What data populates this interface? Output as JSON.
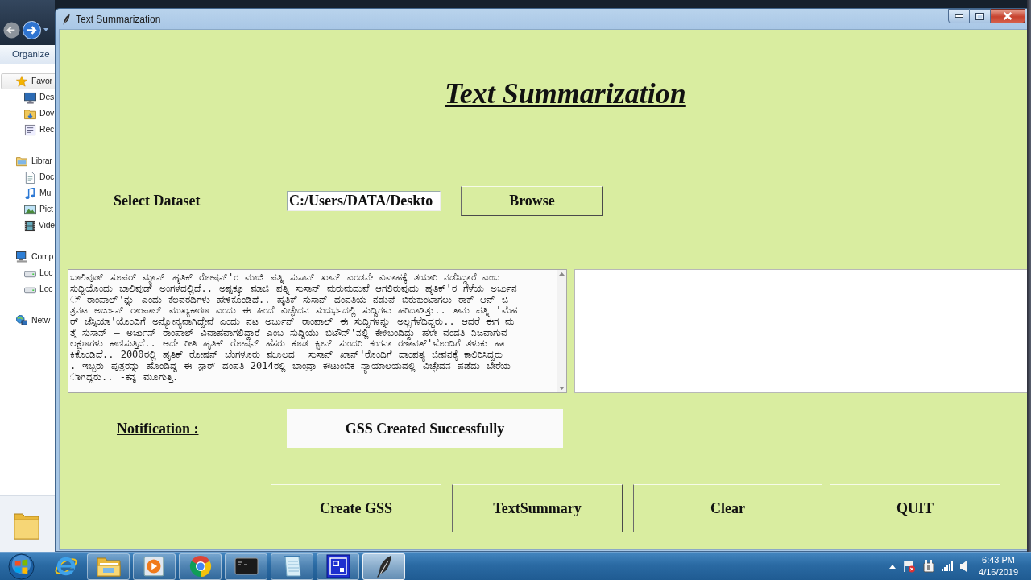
{
  "explorer": {
    "toolbar": "Organize",
    "nav": [
      {
        "label": "Favor",
        "kind": "favorites",
        "selected": true,
        "children": [
          {
            "label": "Des",
            "kind": "desktop",
            "selected": false
          },
          {
            "label": "Dov",
            "kind": "downloads",
            "selected": false
          },
          {
            "label": "Rec",
            "kind": "recent",
            "selected": false
          }
        ]
      },
      {
        "label": "Librar",
        "kind": "libraries",
        "selected": false,
        "children": [
          {
            "label": "Doc",
            "kind": "documents",
            "selected": false
          },
          {
            "label": "Mu",
            "kind": "music",
            "selected": false
          },
          {
            "label": "Pict",
            "kind": "pictures",
            "selected": false
          },
          {
            "label": "Vide",
            "kind": "videos",
            "selected": false
          }
        ]
      },
      {
        "label": "Comp",
        "kind": "computer",
        "selected": false,
        "children": [
          {
            "label": "Loc",
            "kind": "drive",
            "selected": false
          },
          {
            "label": "Loc",
            "kind": "drive",
            "selected": false
          }
        ]
      },
      {
        "label": "Netw",
        "kind": "network",
        "selected": false
      }
    ]
  },
  "window": {
    "title": "Text Summarization"
  },
  "heading": "Text Summarization",
  "dataset": {
    "label": "Select Dataset",
    "value": "C:/Users/DATA/Deskto",
    "button": "Browse"
  },
  "input_text": {
    "lines": [
      "ಬಾಲಿವುಡ್ ಸೂಪರ್ ಮ್ಯಾನ್ ಹೃತಿಕ್ ರೋಷನ್'ರ ಮಾಜಿ ಪತ್ನಿ ಸುಸಾನ್ ಖಾನ್ ಎರಡನೇ ವಿವಾಹಕ್ಕೆ ತಯಾರಿ ನಡೆಸಿದ್ದಾರೆ ಎಂಬ",
      "ಸುದ್ದಿಯೊಂದು ಬಾಲಿವುಡ್ ಅಂಗಳದಲ್ಲಿದೆ.. ಅಷ್ಟಕ್ಕೂ ಮಾಜಿ ಪತ್ನಿ ಸುಸಾನ್ ಮರುಮದುವೆ ಆಗಲಿರುವುದು ಹೃತಿಕ್'ರ ಗೆಳೆಯ ಅರ್ಜುನ",
      "್ ರಾಂಪಾಲ್'ನ್ನು ಎಂದು ಕೆಲವರದಿಗಳು ಹೇಳಿಕೊಂಡಿದೆ.. ಹೃತಿಕ್-ಸುಸಾನ್ ದಂಪತಿಯ ನಡುವೆ ಬಿರುಕುಂಟಾಗಲು ರಾಕ್ ಆನ್ ಚಿ",
      "ತ್ರನಟ ಅರ್ಜುನ್ ರಾಂಪಾಲ್ ಮುಖ್ಯಕಾರಣ ಎಂದು ಈ ಹಿಂದೆ ವಿಚ್ಛೇದನ ಸಂದರ್ಭದಲ್ಲಿ ಸುದ್ದಿಗಳು ಹರಿದಾಡಿತ್ತು.. ತಾನು ಪತ್ನಿ 'ಮೆಹ",
      "ರ್ ಜೆಸ್ಸಿಯಾ'ಯೊಂದಿಗೆ ಅನ್ಯೋನ್ಯವಾಗಿದ್ದೇವೆ ಎಂದು ನಟ ಅರ್ಜುನ್ ರಾಂಪಾಲ್ ಈ ಸುದ್ದಿಗಳನ್ನು ಅಲ್ಲಗೆಳೆದಿದ್ದರು.. ಆದರೆ ಈಗ ಮ",
      "ತ್ತೆ ಸುಸಾನ್ – ಅರ್ಜುನ್ ರಾಂಪಾಲ್ ವಿವಾಹವಾಗಲಿದ್ದಾರೆ ಎಂಬ ಸುದ್ದಿಯು ಬಿಟೌನ್'ನಲ್ಲಿ ಕೇಳಿಬಂದಿದ್ದು ಹಳೇ ವಂದತಿ ನಿಜವಾಗುವ",
      "ಲಕ್ಷಣಗಳು ಕಾಣಿಸುತ್ತಿದೆ.. ಅದೇ ರೀತಿ ಹೃತಿಕ್ ರೋಷನ್ ಹೆಸರು ಕೂಡ ಕ್ವೀನ್ ಸುಂದರಿ ಕಂಗನಾ ರಣಾವತ್'ಳೊಂದಿಗೆ ತಳುಕು ಹಾ",
      "ಕಿಕೊಂಡಿದೆ.. 2000ರಲ್ಲಿ ಹೃತಿಕ್ ರೋಷನ್ ಬೆಂಗಳೂರು ಮೂಲದ  ಸುಸಾನ್ ಖಾನ್'ರೊಂದಿಗೆ ದಾಂಪತ್ಯ ಜೀವನಕ್ಕೆ ಕಾಲಿರಿಸಿದ್ದರು",
      ". ಇಬ್ಬರು ಪುತ್ರರನ್ನು ಹೊಂದಿದ್ದ ಈ ಸ್ಟಾರ್ ದಂಪತಿ 2014ರಲ್ಲಿ ಬಾಂದ್ರಾ ಕೌಟುಂಬಿಕ ನ್ಯಾಯಾಲಯದಲ್ಲಿ ವಿಚ್ಛೇದನ ಪಡೆದು ಬೇರೆಯ",
      "ಾಗಿದ್ದರು.. -ಕನ್ನ ಮೂಗುತ್ತಿ."
    ]
  },
  "notification": {
    "label": "Notification :",
    "message": "GSS Created Successfully"
  },
  "buttons": [
    "Create GSS",
    "TextSummary",
    "Clear",
    "QUIT"
  ],
  "taskbar": {
    "apps": [
      {
        "kind": "browser",
        "running": false,
        "selected": false
      },
      {
        "kind": "folder",
        "running": true,
        "selected": false
      },
      {
        "kind": "media",
        "running": true,
        "selected": false
      },
      {
        "kind": "chrome",
        "running": true,
        "selected": false
      },
      {
        "kind": "terminal",
        "running": true,
        "selected": false
      },
      {
        "kind": "notepad",
        "running": true,
        "selected": false
      },
      {
        "kind": "blue-app",
        "running": true,
        "selected": false
      },
      {
        "kind": "feather",
        "running": true,
        "selected": true
      }
    ],
    "clock": {
      "time": "6:43 PM",
      "date": "4/16/2019"
    }
  }
}
